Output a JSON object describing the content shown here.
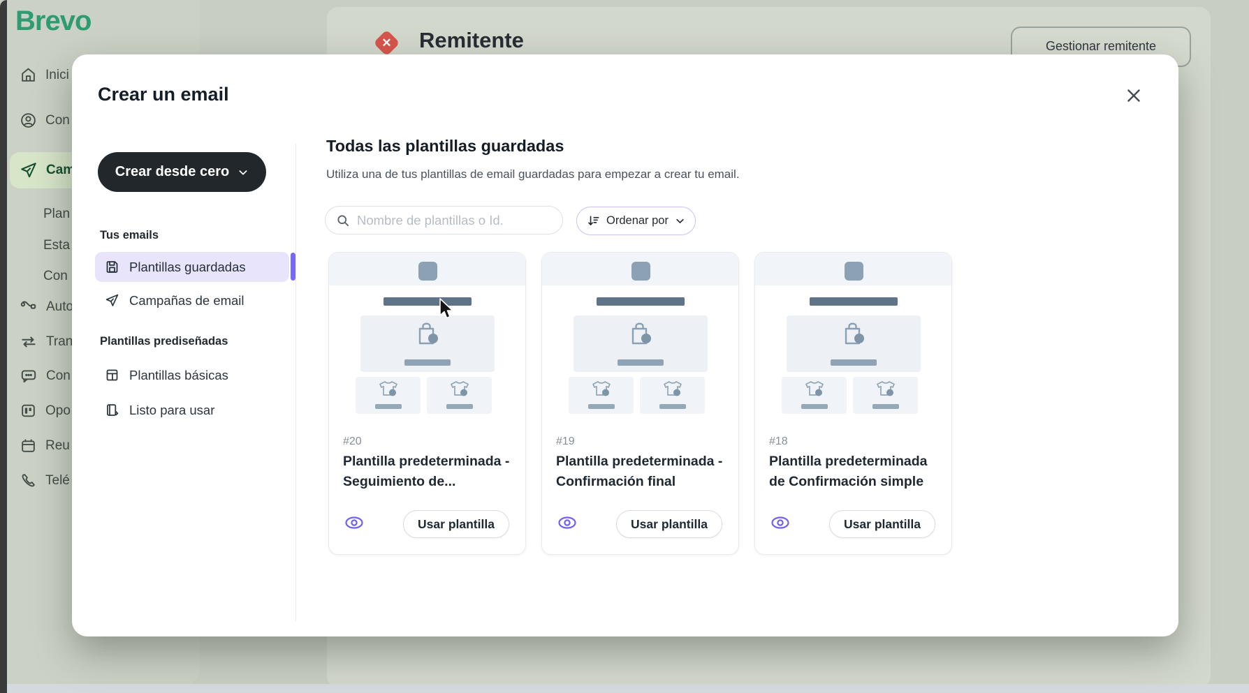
{
  "app": {
    "brand": "Brevo"
  },
  "colors": {
    "accent_purple": "#776af0",
    "brand_green": "#2f9b71",
    "dark_button": "#22272c",
    "error_red": "#d7554c",
    "selected_item_bg": "#e7e4fc"
  },
  "background": {
    "sidebar": {
      "items": [
        {
          "label": "Inici",
          "icon": "home"
        },
        {
          "label": "Con",
          "icon": "contacts"
        },
        {
          "label": "Cam",
          "icon": "campaigns",
          "active": true
        },
        {
          "label": "Plan",
          "sub": true
        },
        {
          "label": "Esta",
          "sub": true
        },
        {
          "label": "Con",
          "sub": true
        },
        {
          "label": "Auto",
          "icon": "automations"
        },
        {
          "label": "Tran",
          "icon": "transactional"
        },
        {
          "label": "Con",
          "icon": "conversations"
        },
        {
          "label": "Opo",
          "icon": "deals"
        },
        {
          "label": "Reu",
          "icon": "meetings"
        },
        {
          "label": "Telé",
          "icon": "phone"
        }
      ]
    },
    "page": {
      "section_title": "Remitente",
      "manage_button": "Gestionar remitente"
    }
  },
  "modal": {
    "title": "Crear un email",
    "left_panel": {
      "create_button": "Crear desde cero",
      "sections": [
        {
          "heading": "Tus emails",
          "items": [
            {
              "label": "Plantillas guardadas",
              "icon": "saved-template",
              "selected": true
            },
            {
              "label": "Campañas de email",
              "icon": "paper-plane"
            }
          ]
        },
        {
          "heading": "Plantillas prediseñadas",
          "items": [
            {
              "label": "Plantillas básicas",
              "icon": "basic-layout"
            },
            {
              "label": "Listo para usar",
              "icon": "ready-to-use"
            }
          ]
        }
      ]
    },
    "content": {
      "heading": "Todas las plantillas guardadas",
      "subheading": "Utiliza una de tus plantillas de email guardadas para empezar a crear tu email.",
      "search": {
        "placeholder": "Nombre de plantillas o Id."
      },
      "sort_button": {
        "label": "Ordenar por"
      },
      "cards": [
        {
          "id": "#20",
          "title": "Plantilla predeterminada - Seguimiento de...",
          "action": "Usar plantilla"
        },
        {
          "id": "#19",
          "title": "Plantilla predeterminada - Confirmación final",
          "action": "Usar plantilla"
        },
        {
          "id": "#18",
          "title": "Plantilla predeterminada de Confirmación simple",
          "action": "Usar plantilla"
        }
      ]
    }
  }
}
